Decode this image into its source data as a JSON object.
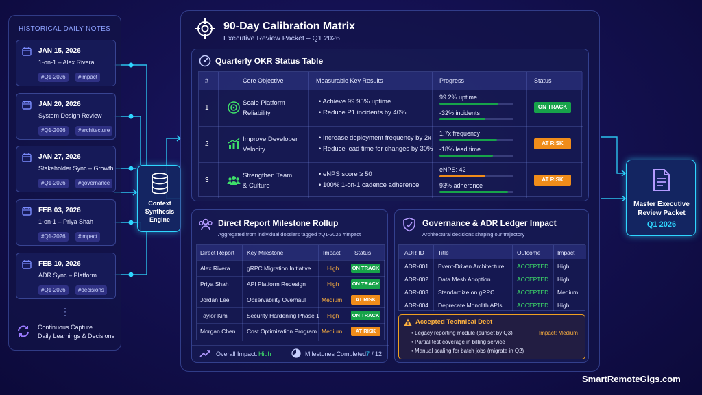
{
  "left_panel": {
    "title": "HISTORICAL DAILY NOTES",
    "notes": [
      {
        "date": "JAN 15, 2026",
        "title": "1-on-1 – Alex Rivera",
        "tags": [
          "#Q1-2026",
          "#impact"
        ]
      },
      {
        "date": "JAN 20, 2026",
        "title": "System Design Review",
        "tags": [
          "#Q1-2026",
          "#architecture"
        ]
      },
      {
        "date": "JAN 27, 2026",
        "title": "Stakeholder Sync – Growth",
        "tags": [
          "#Q1-2026",
          "#governance"
        ]
      },
      {
        "date": "FEB 03, 2026",
        "title": "1-on-1 – Priya Shah",
        "tags": [
          "#Q1-2026",
          "#impact"
        ]
      },
      {
        "date": "FEB 10, 2026",
        "title": "ADR Sync – Platform",
        "tags": [
          "#Q1-2026",
          "#decisions"
        ]
      }
    ],
    "continuous_line1": "Continuous Capture",
    "continuous_line2": "Daily Learnings & Decisions"
  },
  "engine": {
    "line1": "Context",
    "line2": "Synthesis",
    "line3": "Engine"
  },
  "main": {
    "title": "90-Day Calibration Matrix",
    "subtitle": "Executive Review Packet – Q1 2026"
  },
  "okr": {
    "title": "Quarterly OKR Status Table",
    "headers": [
      "#",
      "Core Objective",
      "Measurable Key Results",
      "Progress",
      "Status"
    ],
    "rows": [
      {
        "num": "1",
        "objective_line1": "Scale Platform",
        "objective_line2": "Reliability",
        "kr1": "• Achieve 99.95% uptime",
        "kr2": "• Reduce P1 incidents by 40%",
        "p1_label": "99.2% uptime",
        "p1_value": 0.8,
        "p2_label": "-32% incidents",
        "p2_value": 0.62,
        "status": "ON TRACK",
        "status_color": "#17a34a"
      },
      {
        "num": "2",
        "objective_line1": "Improve Developer",
        "objective_line2": "Velocity",
        "kr1": "• Increase deployment frequency by 2x",
        "kr2": "• Reduce lead time for changes by 30%",
        "p1_label": "1.7x frequency",
        "p1_value": 0.78,
        "p2_label": "-18% lead time",
        "p2_value": 0.72,
        "status": "AT RISK",
        "status_color": "#f08c1a"
      },
      {
        "num": "3",
        "objective_line1": "Strengthen Team",
        "objective_line2": "& Culture",
        "kr1": "• eNPS score ≥ 50",
        "kr2": "• 100% 1-on-1 cadence adherence",
        "p1_label": "eNPS: 42",
        "p1_value": 0.62,
        "p2_label": "93% adherence",
        "p2_value": 0.93,
        "status": "AT RISK",
        "status_color": "#f08c1a"
      }
    ]
  },
  "milestones": {
    "title": "Direct Report Milestone Rollup",
    "subtitle": "Aggregated from individual dossiers tagged #Q1-2026 #impact",
    "headers": [
      "Direct Report",
      "Key Milestone",
      "Impact",
      "Status"
    ],
    "rows": [
      {
        "name": "Alex Rivera",
        "milestone": "gRPC Migration Initiative",
        "impact": "High",
        "status": "ON TRACK"
      },
      {
        "name": "Priya Shah",
        "milestone": "API Platform Redesign",
        "impact": "High",
        "status": "ON TRACK"
      },
      {
        "name": "Jordan Lee",
        "milestone": "Observability Overhaul",
        "impact": "Medium",
        "status": "AT RISK"
      },
      {
        "name": "Taylor Kim",
        "milestone": "Security Hardening Phase 1",
        "impact": "High",
        "status": "ON TRACK"
      },
      {
        "name": "Morgan Chen",
        "milestone": "Cost Optimization Program",
        "impact": "Medium",
        "status": "AT RISK"
      }
    ],
    "overall_label": "Overall Impact:",
    "overall_value": "High",
    "completed_label": "Milestones Completed:",
    "completed_value": "7",
    "completed_total": "/ 12"
  },
  "governance": {
    "title": "Governance & ADR Ledger Impact",
    "subtitle": "Architectural decisions shaping our trajectory",
    "headers": [
      "ADR ID",
      "Title",
      "Outcome",
      "Impact"
    ],
    "rows": [
      {
        "id": "ADR-001",
        "title": "Event-Driven Architecture",
        "outcome": "ACCEPTED",
        "impact": "High"
      },
      {
        "id": "ADR-002",
        "title": "Data Mesh Adoption",
        "outcome": "ACCEPTED",
        "impact": "High"
      },
      {
        "id": "ADR-003",
        "title": "Standardize on gRPC",
        "outcome": "ACCEPTED",
        "impact": "Medium"
      },
      {
        "id": "ADR-004",
        "title": "Deprecate Monolith APIs",
        "outcome": "ACCEPTED",
        "impact": "High"
      }
    ],
    "debt_title": "Accepted Technical Debt",
    "debt_items": [
      "• Legacy reporting module (sunset by Q3)",
      "• Partial test coverage in billing service",
      "• Manual scaling for batch jobs (migrate in Q2)"
    ],
    "debt_impact": "Impact: Medium"
  },
  "master": {
    "line1": "Master Executive",
    "line2": "Review Packet",
    "quarter": "Q1 2026"
  },
  "brand": "SmartRemoteGigs.com",
  "colors": {
    "accent": "#2fd6ff",
    "green": "#17a34a",
    "amber": "#f08c1a",
    "amber_text": "#ffb23e",
    "green_text": "#3ee06a"
  }
}
